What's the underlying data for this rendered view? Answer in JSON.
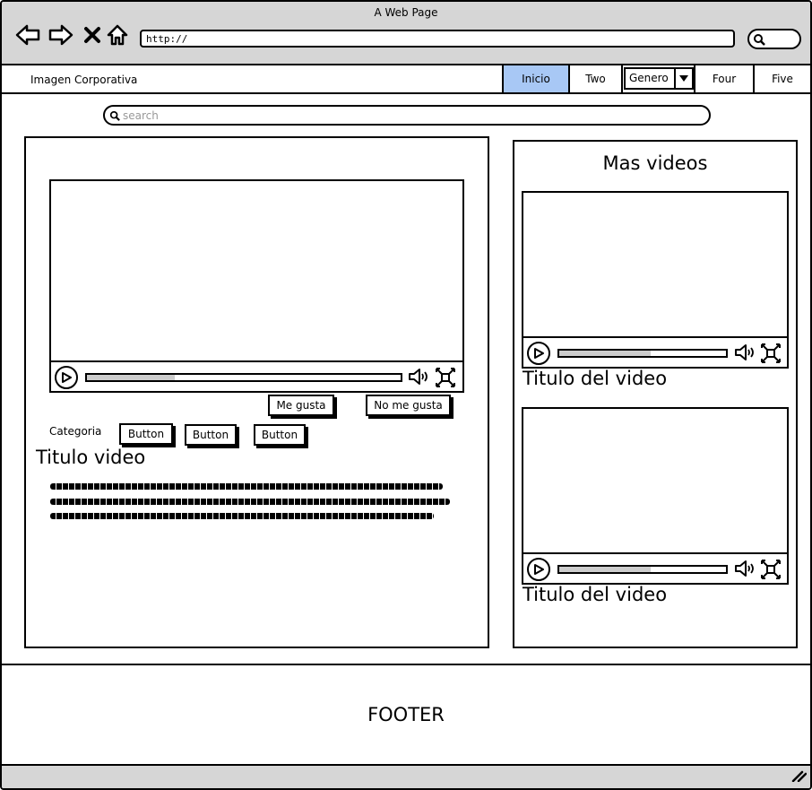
{
  "window": {
    "title": "A Web Page"
  },
  "browser": {
    "url": "http://",
    "nav_icons": [
      "back-arrow-icon",
      "forward-arrow-icon",
      "close-x-icon",
      "home-icon"
    ]
  },
  "navbar": {
    "brand": "Imagen Corporativa",
    "tabs": [
      {
        "label": "Inicio",
        "active": true
      },
      {
        "label": "Two",
        "active": false
      },
      {
        "label": "Genero",
        "type": "select"
      },
      {
        "label": "Four",
        "active": false
      },
      {
        "label": "Five",
        "active": false
      }
    ]
  },
  "search": {
    "placeholder": "search"
  },
  "main": {
    "video": {
      "progress_fraction": 0.28
    },
    "buttons": {
      "like": "Me gusta",
      "dislike": "No me gusta"
    },
    "category": {
      "label": "Categoria",
      "buttons": [
        "Button",
        "Button",
        "Button"
      ]
    },
    "title": "Titulo video"
  },
  "sidebar": {
    "heading": "Mas videos",
    "videos": [
      {
        "title": "Titulo del video",
        "progress_fraction": 0.55
      },
      {
        "title": "Titulo del video",
        "progress_fraction": 0.55
      }
    ]
  },
  "footer": {
    "text": "FOOTER"
  },
  "colors": {
    "active_tab": "#a8c8f5",
    "chrome": "#d6d6d6"
  }
}
